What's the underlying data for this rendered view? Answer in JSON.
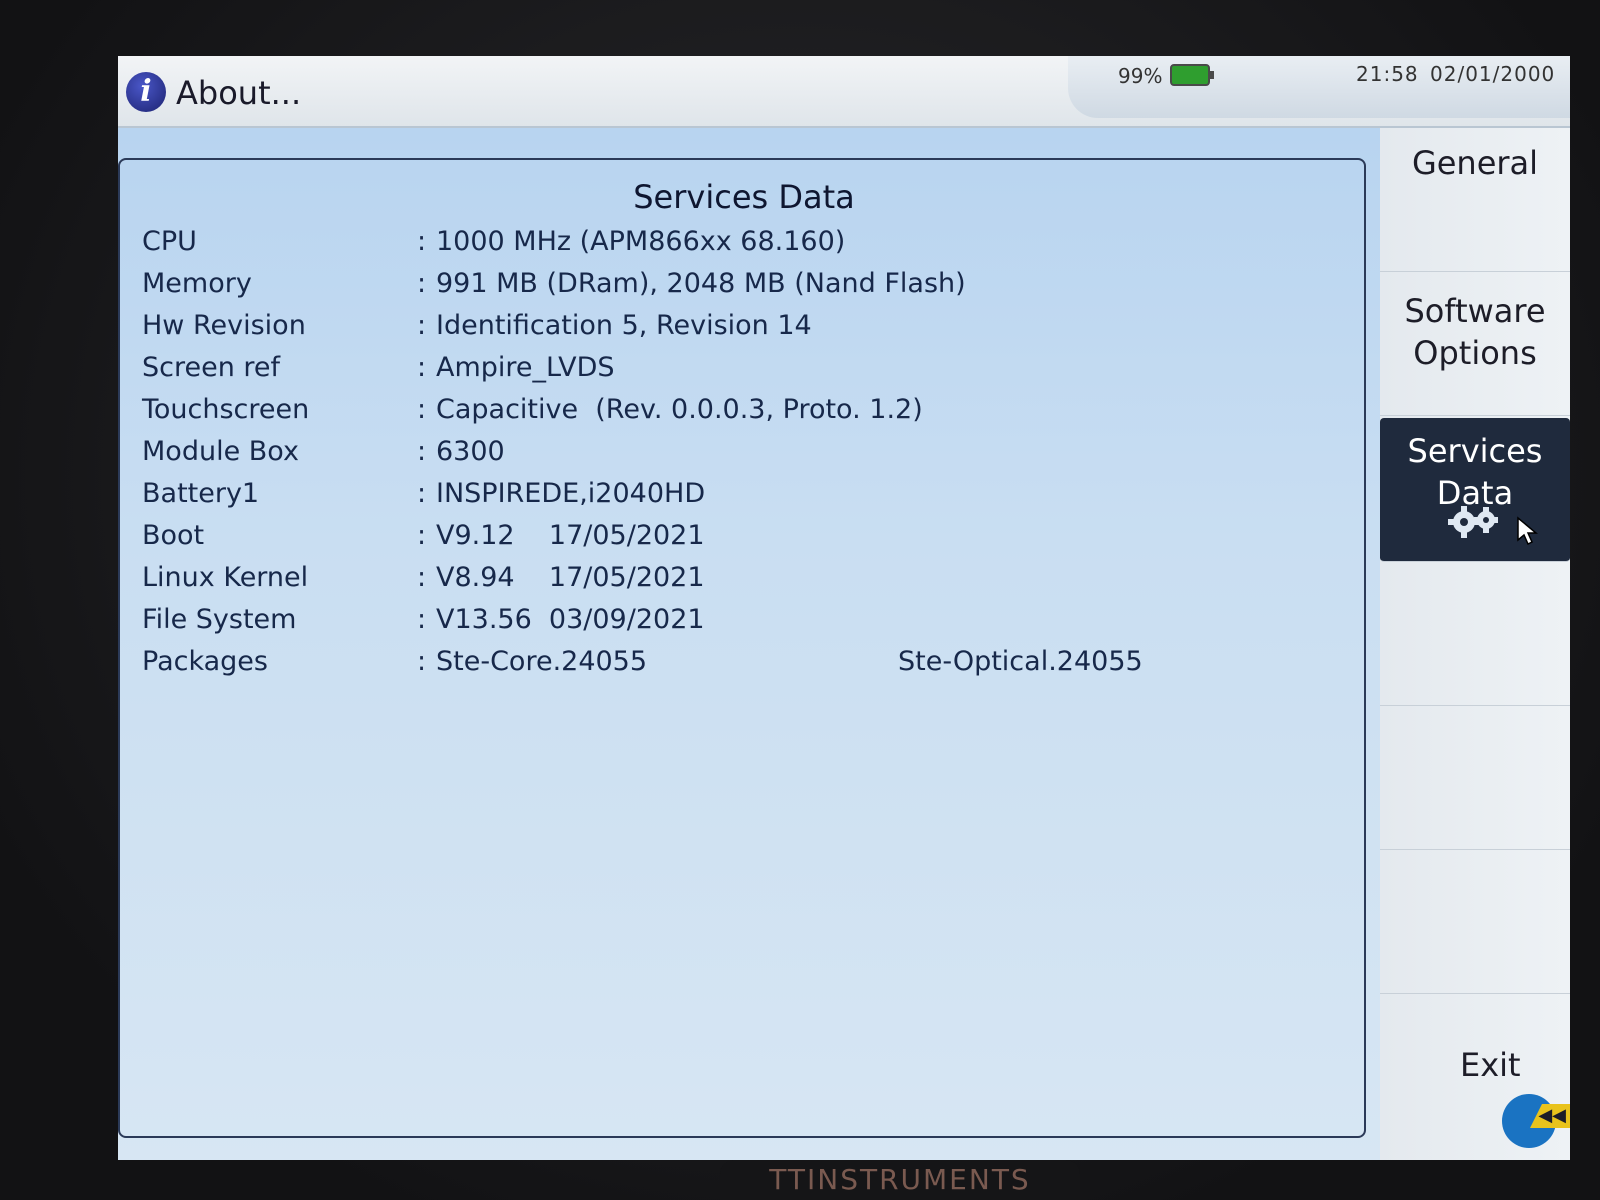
{
  "header": {
    "title": "About...",
    "battery": "99%",
    "time": "21:58",
    "date": "02/01/2000"
  },
  "panel": {
    "title": "Services Data",
    "separator": ":",
    "rows": [
      {
        "label": "CPU",
        "value": "1000 MHz (APM866xx 68.160)"
      },
      {
        "label": "Memory",
        "value": "991 MB (DRam), 2048 MB (Nand Flash)"
      },
      {
        "label": "Hw Revision",
        "value": "Identification 5, Revision 14"
      },
      {
        "label": "Screen ref",
        "value": "Ampire_LVDS"
      },
      {
        "label": "Touchscreen",
        "value": "Capacitive  (Rev. 0.0.0.3, Proto. 1.2)"
      },
      {
        "label": "Module Box",
        "value": "6300"
      },
      {
        "label": "Battery1",
        "value": "INSPIREDE,i2040HD"
      },
      {
        "label": "Boot",
        "value": "V9.12    17/05/2021"
      },
      {
        "label": "Linux Kernel",
        "value": "V8.94    17/05/2021"
      },
      {
        "label": "File System",
        "value": "V13.56  03/09/2021"
      },
      {
        "label": "Packages",
        "value": "Ste-Core.24055",
        "value2": "Ste-Optical.24055"
      }
    ]
  },
  "sidebar": {
    "general": "General",
    "software_options_1": "Software",
    "software_options_2": "Options",
    "services_data_1": "Services",
    "services_data_2": "Data",
    "exit": "Exit"
  },
  "brand": "TTINSTRUMENTS",
  "colors": {
    "active_tab": "#1f2a3d",
    "exit_dot": "#1a73c2",
    "battery": "#2f9e2f"
  }
}
